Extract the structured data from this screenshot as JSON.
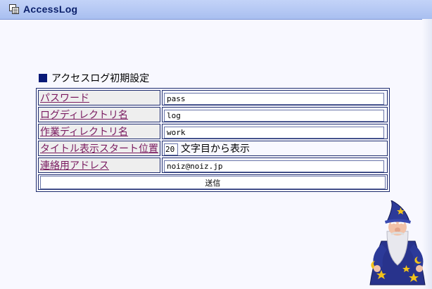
{
  "window": {
    "title": "AccessLog",
    "icon": "window-icon"
  },
  "form": {
    "heading": "アクセスログ初期設定",
    "fields": [
      {
        "label": "パスワード",
        "value": "pass"
      },
      {
        "label": "ログディレクトリ名",
        "value": "log"
      },
      {
        "label": "作業ディレクトリ名",
        "value": "work"
      },
      {
        "label": "タイトル表示スタート位置",
        "value": "20",
        "suffix": "文字目から表示"
      },
      {
        "label": "連絡用アドレス",
        "value": "noiz@noiz.jp"
      }
    ],
    "submit_label": "送信"
  },
  "assistant": {
    "icon": "wizard-assistant-icon",
    "colors": {
      "robe": "#28338c",
      "stars": "#f2c21a",
      "beard": "#e8e8ee",
      "face": "#f2c2a8"
    }
  }
}
